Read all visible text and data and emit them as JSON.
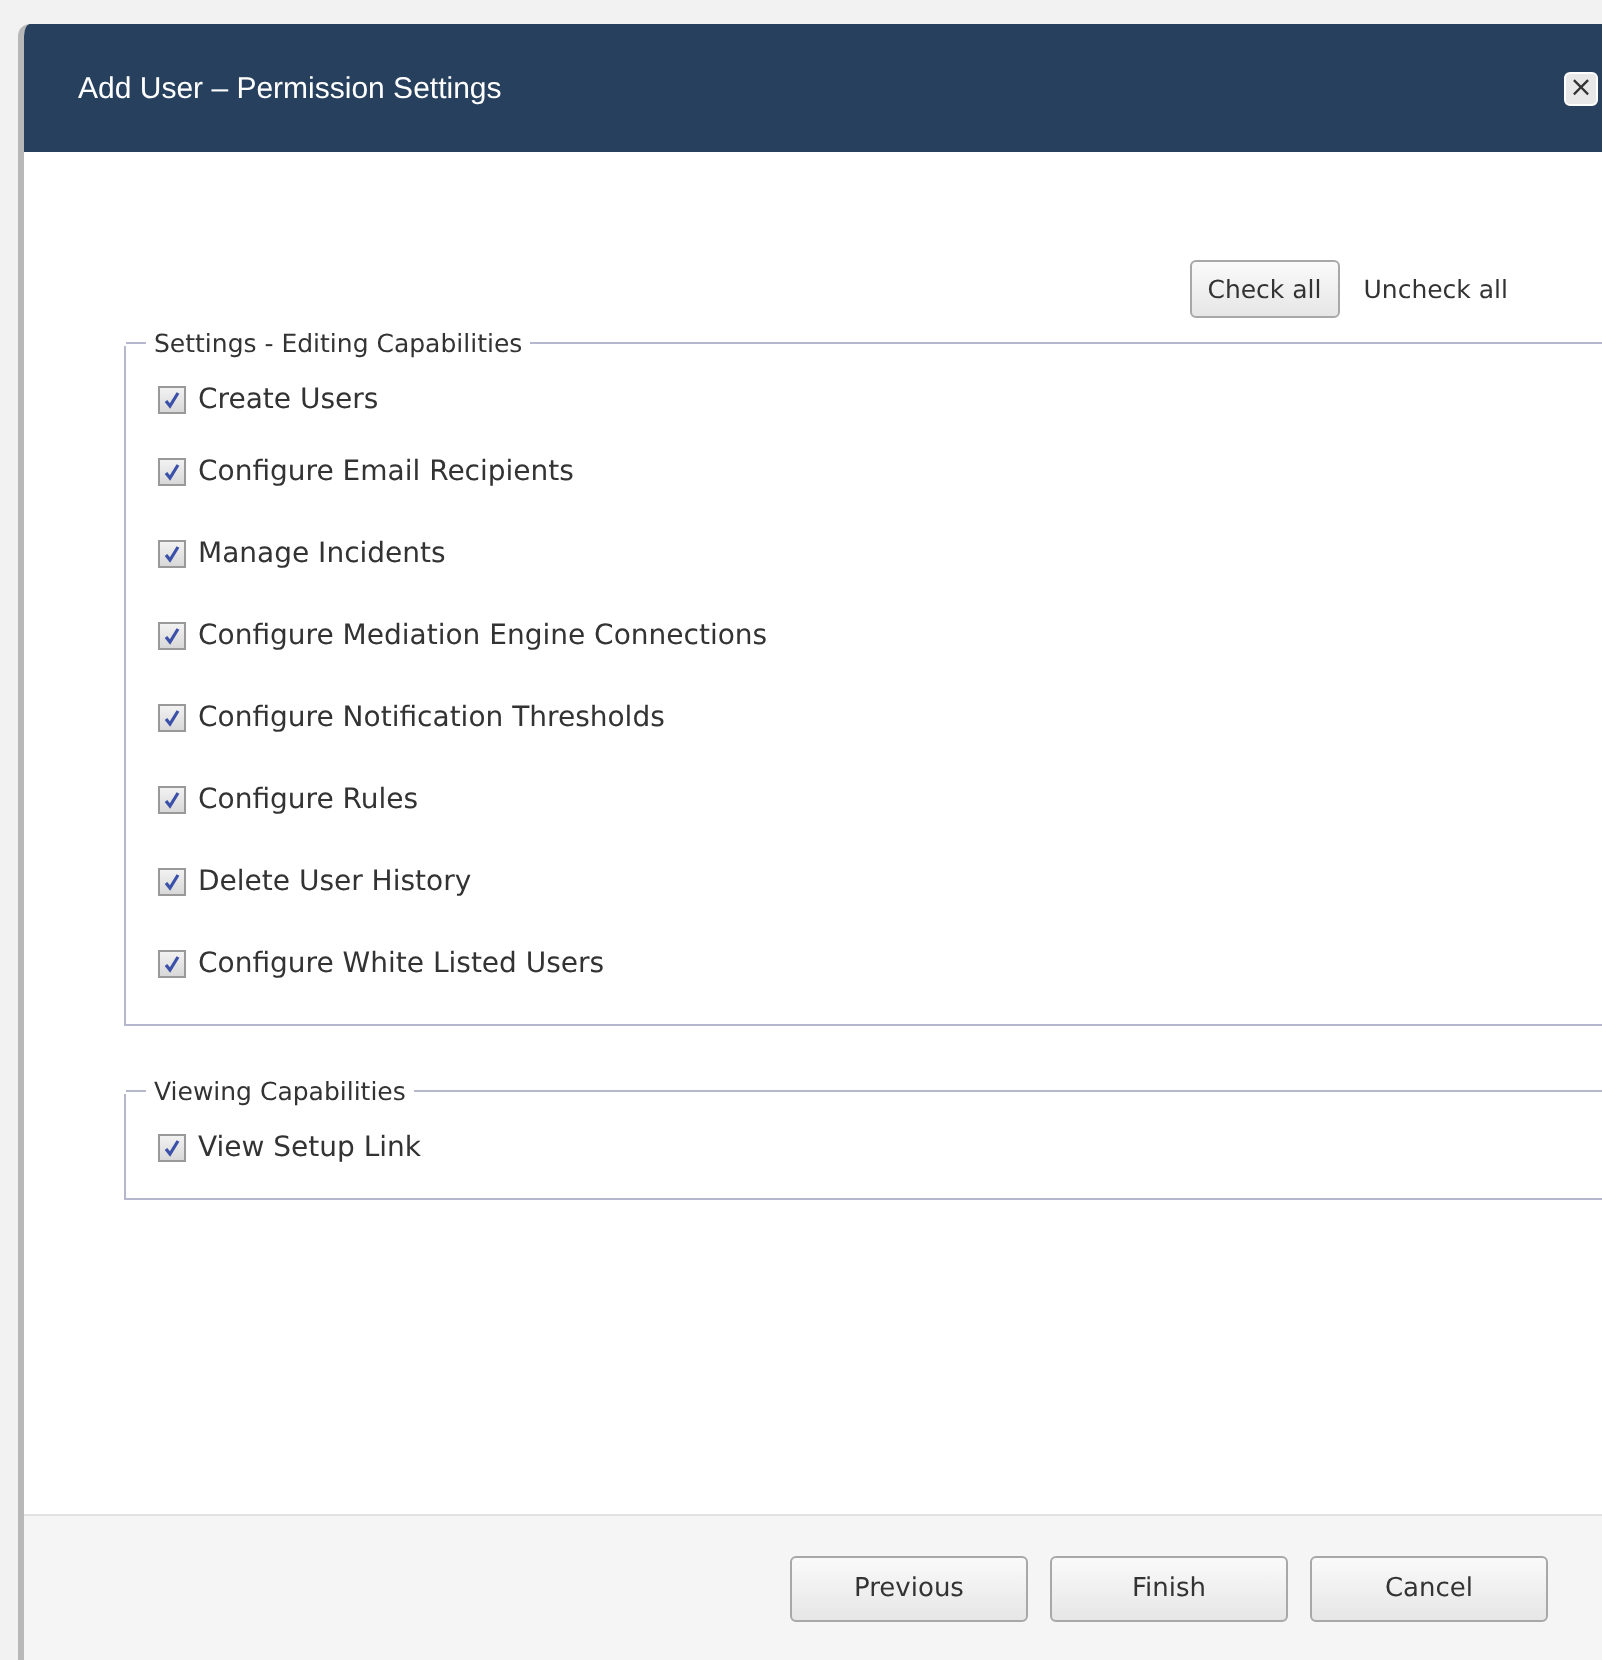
{
  "dialog": {
    "title": "Add User – Permission Settings",
    "close": "×"
  },
  "toolbar": {
    "check_all": "Check all",
    "uncheck_all": "Uncheck all"
  },
  "groups": [
    {
      "legend": "Settings - Editing Capabilities",
      "items": [
        {
          "label": "Create Users",
          "checked": true
        },
        {
          "label": "Configure Email Recipients",
          "checked": true
        },
        {
          "label": "Manage Incidents",
          "checked": true
        },
        {
          "label": "Configure Mediation Engine Connections",
          "checked": true
        },
        {
          "label": "Configure Notification Thresholds",
          "checked": true
        },
        {
          "label": "Configure Rules",
          "checked": true
        },
        {
          "label": "Delete User History",
          "checked": true
        },
        {
          "label": "Configure White Listed Users",
          "checked": true
        }
      ]
    },
    {
      "legend": "Viewing Capabilities",
      "items": [
        {
          "label": "View Setup Link",
          "checked": true
        }
      ]
    }
  ],
  "buttons": [
    "Previous",
    "Finish",
    "Cancel"
  ]
}
